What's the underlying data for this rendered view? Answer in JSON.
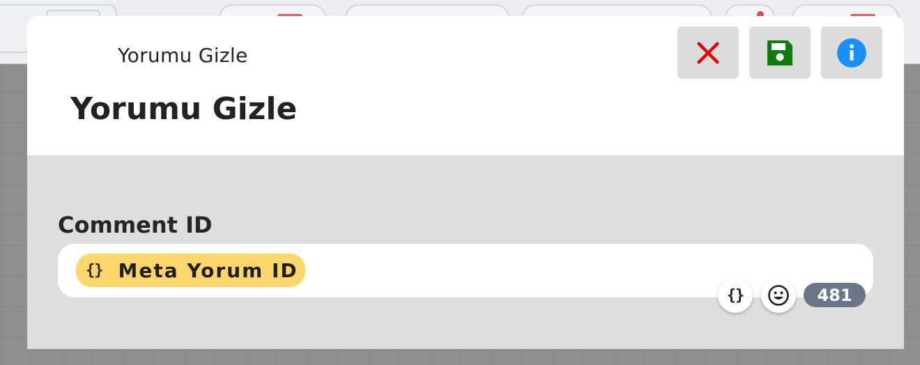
{
  "modal": {
    "header_small_title": "Yorumu Gizle",
    "header_title": "Yorumu Gizle",
    "buttons": {
      "close_icon": "close-icon",
      "save_icon": "save-icon",
      "info_icon": "info-icon"
    }
  },
  "field": {
    "label": "Comment ID",
    "variable_chip": {
      "icon": "{}",
      "label": "Meta Yorum ID"
    },
    "tools": {
      "variable_icon": "{}",
      "emoji_icon": "emoji-icon"
    },
    "char_count": "481"
  },
  "colors": {
    "close": "#e60000",
    "save": "#0a7d0a",
    "info": "#1a90ff",
    "chip": "#fcd66a",
    "badge": "#6b7689"
  }
}
